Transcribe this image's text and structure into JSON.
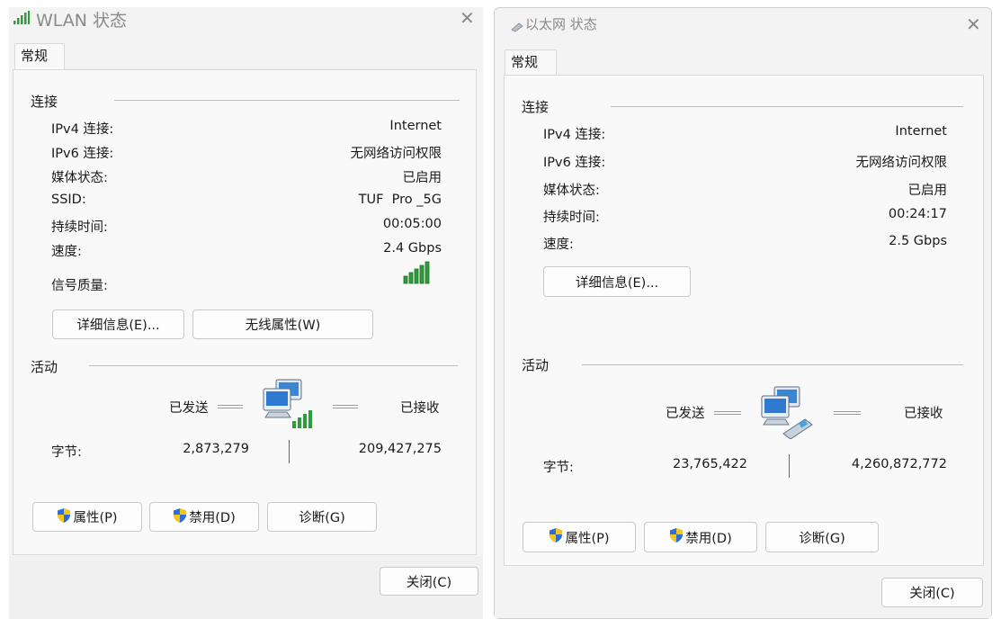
{
  "wlan": {
    "title": "WLAN 状态",
    "tab": "常规",
    "connection_header": "连接",
    "rows": [
      {
        "label": "IPv4 连接:",
        "value": "Internet"
      },
      {
        "label": "IPv6 连接:",
        "value": "无网络访问权限"
      },
      {
        "label": "媒体状态:",
        "value": "已启用"
      },
      {
        "label": "SSID:",
        "value": "TUF  Pro _5G"
      },
      {
        "label": "持续时间:",
        "value": "00:05:00"
      },
      {
        "label": "速度:",
        "value": "2.4 Gbps"
      }
    ],
    "signal_label": "信号质量:",
    "signal_bars_filled": 5,
    "signal_bars_total": 5,
    "details_button": "详细信息(E)...",
    "wireless_props_button": "无线属性(W)",
    "activity_header": "活动",
    "sent_label": "已发送",
    "received_label": "已接收",
    "bytes_label": "字节:",
    "bytes_sent": "2,873,279",
    "bytes_received": "209,427,275",
    "properties_button": "属性(P)",
    "disable_button": "禁用(D)",
    "diagnose_button": "诊断(G)",
    "close_button": "关闭(C)"
  },
  "ethernet": {
    "title": "以太网 状态",
    "tab": "常规",
    "connection_header": "连接",
    "rows": [
      {
        "label": "IPv4 连接:",
        "value": "Internet"
      },
      {
        "label": "IPv6 连接:",
        "value": "无网络访问权限"
      },
      {
        "label": "媒体状态:",
        "value": "已启用"
      },
      {
        "label": "持续时间:",
        "value": "00:24:17"
      },
      {
        "label": "速度:",
        "value": "2.5 Gbps"
      }
    ],
    "details_button": "详细信息(E)...",
    "activity_header": "活动",
    "sent_label": "已发送",
    "received_label": "已接收",
    "bytes_label": "字节:",
    "bytes_sent": "23,765,422",
    "bytes_received": "4,260,872,772",
    "properties_button": "属性(P)",
    "disable_button": "禁用(D)",
    "diagnose_button": "诊断(G)",
    "close_button": "关闭(C)"
  },
  "colors": {
    "window_bg": "#f3f3f3",
    "panel_bg": "#f9f9f9",
    "signal_green": "#2e9c3a",
    "title_gray": "#8a8a8a"
  },
  "icons": [
    "wifi-title-icon",
    "ethernet-title-icon",
    "close-icon",
    "signal-strength-icon",
    "network-computers-icon",
    "uac-shield-icon"
  ]
}
